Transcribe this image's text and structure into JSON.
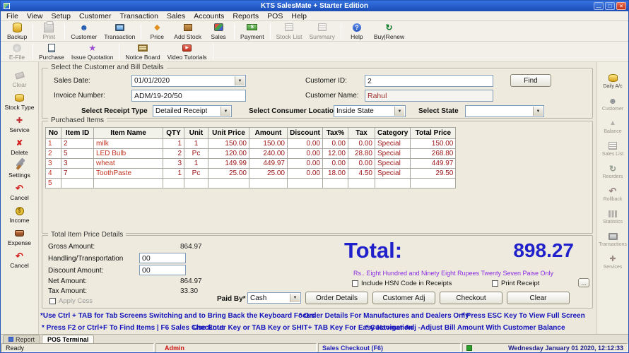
{
  "window": {
    "title": "KTS SalesMate + Starter Edition"
  },
  "menu": [
    "File",
    "View",
    "Setup",
    "Customer",
    "Transaction",
    "Sales",
    "Accounts",
    "Reports",
    "POS",
    "Help"
  ],
  "toolbar_row1": [
    {
      "label": "Backup"
    },
    {
      "label": "Print"
    },
    {
      "label": "Customer"
    },
    {
      "label": "Transaction"
    },
    {
      "label": "Price"
    },
    {
      "label": "Add Stock"
    },
    {
      "label": "Sales"
    },
    {
      "label": "Payment"
    },
    {
      "label": "Stock List"
    },
    {
      "label": "Summary"
    },
    {
      "label": "Help"
    },
    {
      "label": "Buy|Renew"
    }
  ],
  "toolbar_row2": [
    {
      "label": "E-File"
    },
    {
      "label": "Purchase"
    },
    {
      "label": "Issue Quotation"
    },
    {
      "label": "Notice Board"
    },
    {
      "label": "Video Tutorials"
    }
  ],
  "left_rail": [
    {
      "label": "Clear"
    },
    {
      "label": "Stock Type"
    },
    {
      "label": "Service"
    },
    {
      "label": "Delete"
    },
    {
      "label": "Settings"
    },
    {
      "label": "Cancel"
    },
    {
      "label": "Income"
    },
    {
      "label": "Expense"
    },
    {
      "label": "Cancel"
    }
  ],
  "right_rail": [
    {
      "label": "Daily A/c"
    },
    {
      "label": "Customer"
    },
    {
      "label": "Balance"
    },
    {
      "label": "Sales List"
    },
    {
      "label": "Reorders"
    },
    {
      "label": "Rollback"
    },
    {
      "label": "Statistics"
    },
    {
      "label": "Transactions"
    },
    {
      "label": "Services"
    }
  ],
  "bill": {
    "group_title": "Select the Customer and Bill Details",
    "sales_date_label": "Sales Date:",
    "sales_date": "01/01/2020",
    "invoice_label": "Invoice Number:",
    "invoice": "ADM/19-20/50",
    "receipt_type_label": "Select Receipt Type",
    "receipt_type": "Detailed Receipt",
    "consumer_location_label": "Select Consumer Location",
    "consumer_location": "Inside State",
    "state_label": "Select State",
    "state": "",
    "customer_id_label": "Customer ID:",
    "customer_id": "2",
    "customer_name_label": "Customer Name:",
    "customer_name": "Rahul",
    "find_label": "Find"
  },
  "items": {
    "group_title": "Purchased Items",
    "headers": [
      "No",
      "Item ID",
      "Item Name",
      "QTY",
      "Unit",
      "Unit Price",
      "Amount",
      "Discount",
      "Tax%",
      "Tax",
      "Category",
      "Total Price"
    ],
    "rows": [
      [
        "1",
        "2",
        "milk",
        "1",
        "1",
        "150.00",
        "150.00",
        "0.00",
        "0.00",
        "0.00",
        "Special",
        "150.00"
      ],
      [
        "2",
        "5",
        "LED Bulb",
        "2",
        "Pc",
        "120.00",
        "240.00",
        "0.00",
        "12.00",
        "28.80",
        "Special",
        "268.80"
      ],
      [
        "3",
        "3",
        "wheat",
        "3",
        "1",
        "149.99",
        "449.97",
        "0.00",
        "0.00",
        "0.00",
        "Special",
        "449.97"
      ],
      [
        "4",
        "7",
        "ToothPaste",
        "1",
        "Pc",
        "25.00",
        "25.00",
        "0.00",
        "18.00",
        "4.50",
        "Special",
        "29.50"
      ],
      [
        "5",
        "",
        "",
        "",
        "",
        "",
        "",
        "",
        "",
        "",
        "",
        ""
      ]
    ]
  },
  "totals": {
    "group_title": "Total Item Price Details",
    "gross_label": "Gross Amount:",
    "gross": "864.97",
    "handling_label": "Handling/Transportation",
    "handling": "00",
    "discount_label": "Discount Amount:",
    "discount": "00",
    "net_label": "Net Amount:",
    "net": "864.97",
    "tax_label": "Tax Amount:",
    "tax": "33.30",
    "apply_cess_label": "Apply Cess",
    "total_label": "Total:",
    "total_value": "898.27",
    "amount_words": "Rs.. Eight Hundred and Ninety Eight Rupees Twenty Seven Paise Only",
    "hsn_label": "Include HSN Code in Receipts",
    "print_receipt_label": "Print Receipt",
    "dots_label": "...",
    "paid_by_label": "Paid By*",
    "paid_by": "Cash",
    "order_details_label": "Order Details",
    "customer_adj_label": "Customer Adj",
    "checkout_label": "Checkout",
    "clear_label": "Clear"
  },
  "help": {
    "l1a": "*Use Ctrl + TAB for Tab Screens Switching and to Bring Back the  Keyboard Focus",
    "l1b": "* Order Details For Manufactures and Dealers Only",
    "l1c": "* Press ESC Key To View Full Screen",
    "l2a": "* Press F2 or Ctrl+F To Find Items | F6  Sales Checkout",
    "l2b": "Use Enter Key or TAB Key or SHIT+ TAB Key For Easy Navigation",
    "l2c": "* Customer Adj -Adjust Bill Amount With Customer Balance"
  },
  "tabs": {
    "report": "Report",
    "pos": "POS Terminal"
  },
  "status": {
    "ready": "Ready",
    "admin": "Admin",
    "checkout": "Sales Checkout (F6)",
    "datetime": "Wednesday January 01 2020, 12:12:33"
  }
}
